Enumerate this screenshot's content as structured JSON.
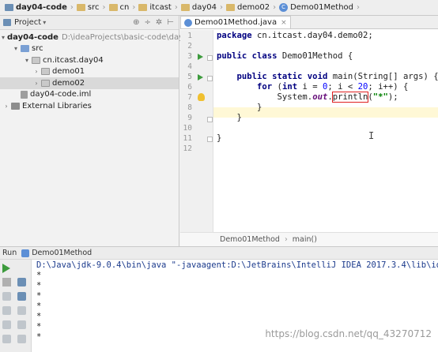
{
  "breadcrumb": [
    {
      "label": "day04-code",
      "icon": "project-folder-icon",
      "bold": true
    },
    {
      "label": "src",
      "icon": "folder-icon"
    },
    {
      "label": "cn",
      "icon": "folder-icon"
    },
    {
      "label": "itcast",
      "icon": "folder-icon"
    },
    {
      "label": "day04",
      "icon": "folder-icon"
    },
    {
      "label": "demo02",
      "icon": "folder-icon"
    },
    {
      "label": "Demo01Method",
      "icon": "class-icon"
    }
  ],
  "project_panel": {
    "title": "Project",
    "tree": [
      {
        "label": "day04-code",
        "path": "D:\\ideaProjects\\basic-code\\day04-co",
        "icon": "project-folder-icon",
        "expanded": true,
        "depth": 0
      },
      {
        "label": "src",
        "icon": "source-folder-icon",
        "expanded": true,
        "depth": 1
      },
      {
        "label": "cn.itcast.day04",
        "icon": "package-icon",
        "expanded": true,
        "depth": 2
      },
      {
        "label": "demo01",
        "icon": "package-icon",
        "expanded": false,
        "depth": 3
      },
      {
        "label": "demo02",
        "icon": "package-icon",
        "expanded": false,
        "depth": 3,
        "selected": true
      },
      {
        "label": "day04-code.iml",
        "icon": "module-file-icon",
        "depth": 1
      },
      {
        "label": "External Libraries",
        "icon": "library-icon",
        "expanded": false,
        "depth": 0
      }
    ]
  },
  "editor": {
    "tab_label": "Demo01Method.java",
    "line_numbers": [
      "1",
      "2",
      "3",
      "4",
      "5",
      "6",
      "7",
      "8",
      "9",
      "10",
      "11",
      "12"
    ],
    "status_path": [
      "Demo01Method",
      "main()"
    ]
  },
  "run_panel": {
    "label": "Run",
    "config": "Demo01Method",
    "console_lines": [
      "D:\\Java\\jdk-9.0.4\\bin\\java \"-javaagent:D:\\JetBrains\\IntelliJ IDEA 2017.3.4\\lib\\ide",
      "*",
      "*",
      "*",
      "*",
      "*",
      "*",
      "*"
    ]
  },
  "watermark": "https://blog.csdn.net/qq_43270712",
  "colors": {
    "keyword": "#000080",
    "string": "#008000",
    "number": "#0000ff",
    "highlight_box": "#e02020",
    "run_green": "#3d9b3d"
  }
}
